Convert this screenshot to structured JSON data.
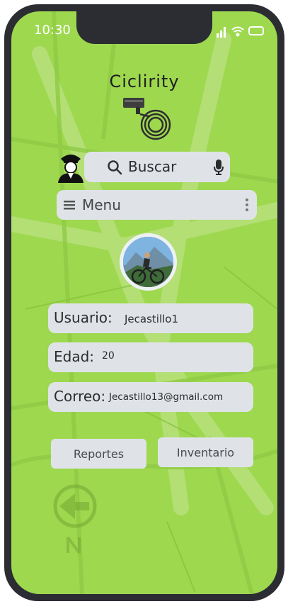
{
  "status": {
    "time": "10:30"
  },
  "brand": {
    "name": "Ciclirity"
  },
  "search": {
    "placeholder": "Buscar"
  },
  "menu": {
    "label": "Menu"
  },
  "profile": {
    "user_label": "Usuario:",
    "user_value": "Jecastillo1",
    "age_label": "Edad:",
    "age_value": "20",
    "email_label": "Correo:",
    "email_value": "Jecastillo13@gmail.com"
  },
  "buttons": {
    "reports": "Reportes",
    "inventory": "Inventario"
  },
  "colors": {
    "background": "#9ed84f",
    "field": "#dfe3e8",
    "frame": "#2b2d33"
  },
  "icons": [
    "police-icon",
    "search-icon",
    "mic-icon",
    "hamburger-icon",
    "kebab-icon",
    "bike-lock-logo",
    "compass-arrow-icon"
  ]
}
